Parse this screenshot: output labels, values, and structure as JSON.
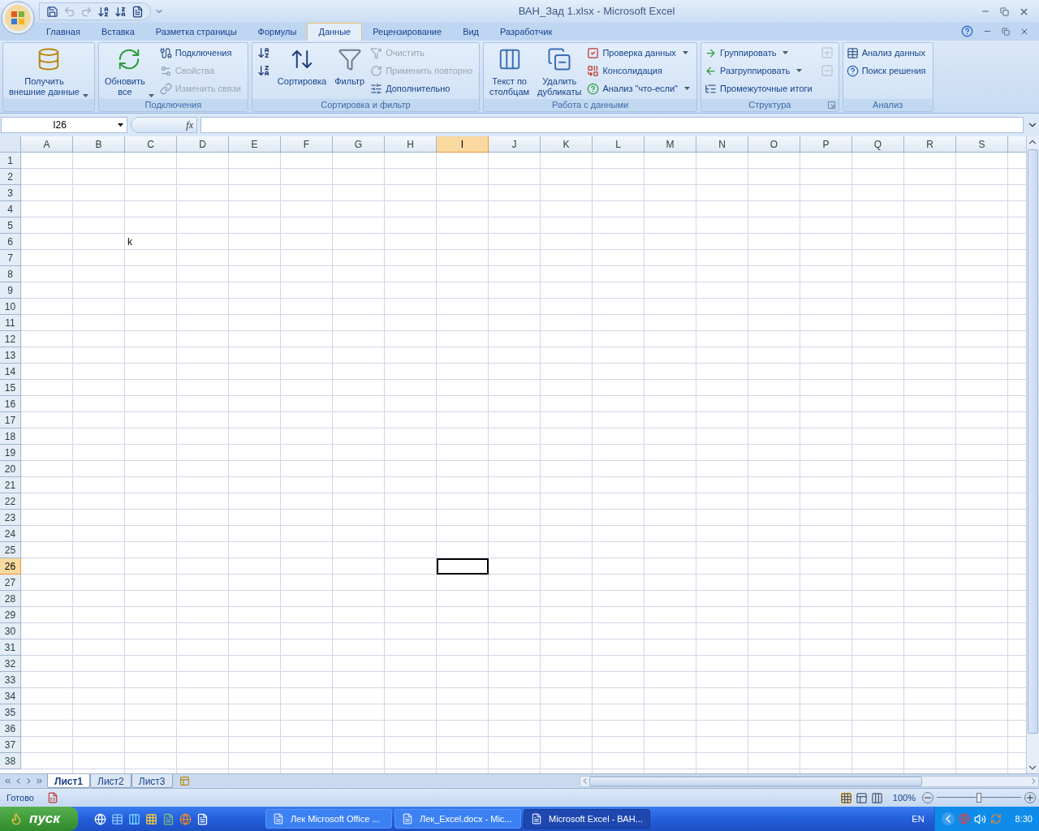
{
  "window": {
    "title": "ВАН_Зад 1.xlsx - Microsoft Excel"
  },
  "tabs": [
    {
      "label": "Главная",
      "selected": false
    },
    {
      "label": "Вставка",
      "selected": false
    },
    {
      "label": "Разметка страницы",
      "selected": false
    },
    {
      "label": "Формулы",
      "selected": false
    },
    {
      "label": "Данные",
      "selected": true
    },
    {
      "label": "Рецензирование",
      "selected": false
    },
    {
      "label": "Вид",
      "selected": false
    },
    {
      "label": "Разработчик",
      "selected": false
    }
  ],
  "ribbon_groups": [
    {
      "launcher": false,
      "buttons": [
        {
          "kind": "large",
          "label": "Получить\nвнешние данные",
          "dropdown": true,
          "disabled": false
        }
      ]
    },
    {
      "title": "Подключения",
      "launcher": false,
      "buttons": [
        {
          "kind": "large",
          "label": "Обновить\nвсе",
          "dropdown": true,
          "disabled": false
        },
        {
          "kind": "small",
          "label": "Подключения",
          "dropdown": false,
          "disabled": false
        },
        {
          "kind": "small",
          "label": "Свойства",
          "dropdown": false,
          "disabled": true
        },
        {
          "kind": "small",
          "label": "Изменить связи",
          "dropdown": false,
          "disabled": true
        }
      ]
    },
    {
      "title": "Сортировка и фильтр",
      "launcher": false,
      "buttons": [
        {
          "kind": "icon",
          "disabled": false
        },
        {
          "kind": "icon",
          "disabled": false
        },
        {
          "kind": "large",
          "label": "Сортировка",
          "dropdown": false,
          "disabled": false
        },
        {
          "kind": "large",
          "label": "Фильтр",
          "dropdown": false,
          "disabled": false
        },
        {
          "kind": "small",
          "label": "Очистить",
          "dropdown": false,
          "disabled": true
        },
        {
          "kind": "small",
          "label": "Применить повторно",
          "dropdown": false,
          "disabled": true
        },
        {
          "kind": "small",
          "label": "Дополнительно",
          "dropdown": false,
          "disabled": false
        }
      ]
    },
    {
      "title": "Работа с данными",
      "launcher": false,
      "buttons": [
        {
          "kind": "large",
          "label": "Текст по\nстолбцам",
          "dropdown": false,
          "disabled": false
        },
        {
          "kind": "large",
          "label": "Удалить\nдубликаты",
          "dropdown": false,
          "disabled": false
        },
        {
          "kind": "small",
          "label": "Проверка данных",
          "dropdown": true,
          "disabled": false
        },
        {
          "kind": "small",
          "label": "Консолидация",
          "dropdown": false,
          "disabled": false
        },
        {
          "kind": "small",
          "label": "Анализ \"что-если\"",
          "dropdown": true,
          "disabled": false
        }
      ]
    },
    {
      "title": "Структура",
      "launcher": true,
      "buttons": [
        {
          "kind": "small",
          "label": "Группировать",
          "dropdown": true,
          "disabled": false
        },
        {
          "kind": "small",
          "label": "Разгруппировать",
          "dropdown": true,
          "disabled": false
        },
        {
          "kind": "small",
          "label": "Промежуточные итоги",
          "dropdown": false,
          "disabled": false
        },
        {
          "kind": "icon",
          "disabled": true
        },
        {
          "kind": "icon",
          "disabled": true
        }
      ]
    },
    {
      "title": "Анализ",
      "launcher": false,
      "buttons": [
        {
          "kind": "small",
          "label": "Анализ данных",
          "dropdown": false,
          "disabled": false
        },
        {
          "kind": "small",
          "label": "Поиск решения",
          "dropdown": false,
          "disabled": false
        }
      ]
    }
  ],
  "name_box": {
    "value": "I26"
  },
  "formula_bar": {
    "function_button": "fx"
  },
  "columns": [
    {
      "label": "A",
      "selected": false
    },
    {
      "label": "B",
      "selected": false
    },
    {
      "label": "C",
      "selected": false
    },
    {
      "label": "D",
      "selected": false
    },
    {
      "label": "E",
      "selected": false
    },
    {
      "label": "F",
      "selected": false
    },
    {
      "label": "G",
      "selected": false
    },
    {
      "label": "H",
      "selected": false
    },
    {
      "label": "I",
      "selected": true
    },
    {
      "label": "J",
      "selected": false
    },
    {
      "label": "K",
      "selected": false
    },
    {
      "label": "L",
      "selected": false
    },
    {
      "label": "M",
      "selected": false
    },
    {
      "label": "N",
      "selected": false
    },
    {
      "label": "O",
      "selected": false
    },
    {
      "label": "P",
      "selected": false
    },
    {
      "label": "Q",
      "selected": false
    },
    {
      "label": "R",
      "selected": false
    },
    {
      "label": "S",
      "selected": false
    }
  ],
  "rows": [
    {
      "label": "1",
      "selected": false
    },
    {
      "label": "2",
      "selected": false
    },
    {
      "label": "3",
      "selected": false
    },
    {
      "label": "4",
      "selected": false
    },
    {
      "label": "5",
      "selected": false
    },
    {
      "label": "6",
      "selected": false,
      "cells": {
        "C": "k"
      }
    },
    {
      "label": "7",
      "selected": false
    },
    {
      "label": "8",
      "selected": false
    },
    {
      "label": "9",
      "selected": false
    },
    {
      "label": "10",
      "selected": false
    },
    {
      "label": "11",
      "selected": false
    },
    {
      "label": "12",
      "selected": false
    },
    {
      "label": "13",
      "selected": false
    },
    {
      "label": "14",
      "selected": false
    },
    {
      "label": "15",
      "selected": false
    },
    {
      "label": "16",
      "selected": false
    },
    {
      "label": "17",
      "selected": false
    },
    {
      "label": "18",
      "selected": false
    },
    {
      "label": "19",
      "selected": false
    },
    {
      "label": "20",
      "selected": false
    },
    {
      "label": "21",
      "selected": false
    },
    {
      "label": "22",
      "selected": false
    },
    {
      "label": "23",
      "selected": false
    },
    {
      "label": "24",
      "selected": false
    },
    {
      "label": "25",
      "selected": false
    },
    {
      "label": "26",
      "selected": true
    },
    {
      "label": "27",
      "selected": false
    },
    {
      "label": "28",
      "selected": false
    },
    {
      "label": "29",
      "selected": false
    },
    {
      "label": "30",
      "selected": false
    },
    {
      "label": "31",
      "selected": false
    },
    {
      "label": "32",
      "selected": false
    },
    {
      "label": "33",
      "selected": false
    },
    {
      "label": "34",
      "selected": false
    },
    {
      "label": "35",
      "selected": false
    },
    {
      "label": "36",
      "selected": false
    },
    {
      "label": "37",
      "selected": false
    },
    {
      "label": "38",
      "selected": false
    }
  ],
  "sheet_tabs": [
    {
      "label": "Лист1",
      "selected": true
    },
    {
      "label": "Лист2",
      "selected": false
    },
    {
      "label": "Лист3",
      "selected": false
    }
  ],
  "status_bar": {
    "text": "Готово",
    "zoom": "100%",
    "zoom_level": {
      "level": 0.5
    }
  },
  "taskbar": {
    "start": "пуск",
    "tasks": [
      {
        "label": "Лек Microsoft Office ...",
        "selected": false
      },
      {
        "label": "Лек_Excel.docx - Mic...",
        "selected": false
      },
      {
        "label": "Microsoft Excel - ВАН...",
        "selected": true
      }
    ],
    "language": "EN",
    "clock": "8:30"
  }
}
